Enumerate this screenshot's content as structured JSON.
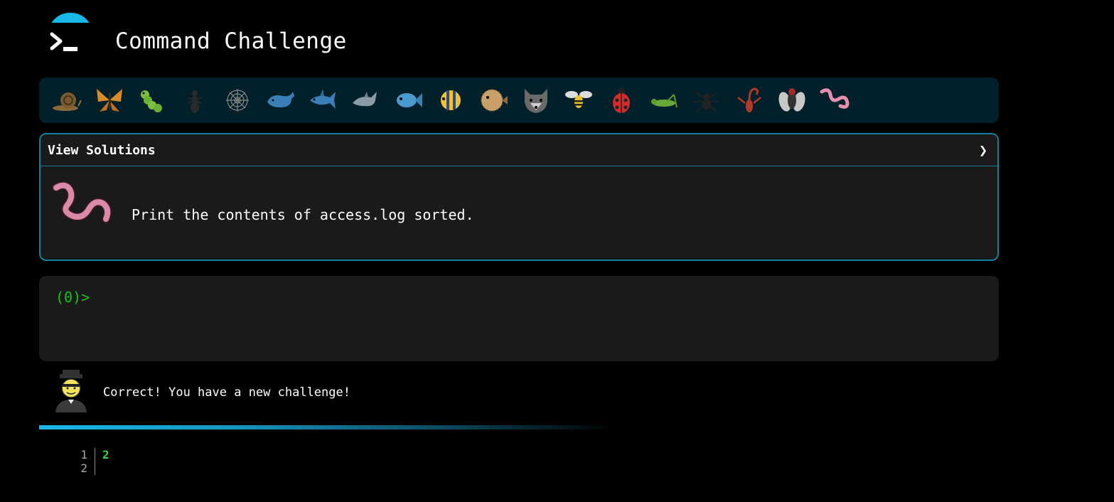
{
  "header": {
    "title": "Command Challenge"
  },
  "levels": [
    {
      "name": "snail-icon"
    },
    {
      "name": "butterfly-icon"
    },
    {
      "name": "caterpillar-icon"
    },
    {
      "name": "ant-icon"
    },
    {
      "name": "spider-web-icon"
    },
    {
      "name": "whale-icon"
    },
    {
      "name": "shark-icon"
    },
    {
      "name": "dolphin-icon"
    },
    {
      "name": "fish-icon"
    },
    {
      "name": "tropical-fish-icon"
    },
    {
      "name": "pufferfish-icon"
    },
    {
      "name": "wolf-icon"
    },
    {
      "name": "bee-icon"
    },
    {
      "name": "ladybug-icon"
    },
    {
      "name": "cricket-icon"
    },
    {
      "name": "spider-icon"
    },
    {
      "name": "scorpion-icon"
    },
    {
      "name": "fly-icon"
    },
    {
      "name": "worm-icon"
    }
  ],
  "solutions": {
    "label": "View Solutions",
    "chevron": "❯",
    "task": "Print the contents of access.log sorted."
  },
  "terminal": {
    "prompt": "(0)>"
  },
  "feedback": {
    "message": "Correct! You have a new challenge!"
  },
  "progress": {
    "fraction": 0.6
  },
  "output": {
    "line_numbers": [
      "1",
      "2"
    ],
    "lines": [
      "2"
    ]
  },
  "colors": {
    "accent": "#1ab8e8",
    "border": "#117e9c",
    "prompt": "#19c319",
    "level_bar": "#01202a"
  }
}
